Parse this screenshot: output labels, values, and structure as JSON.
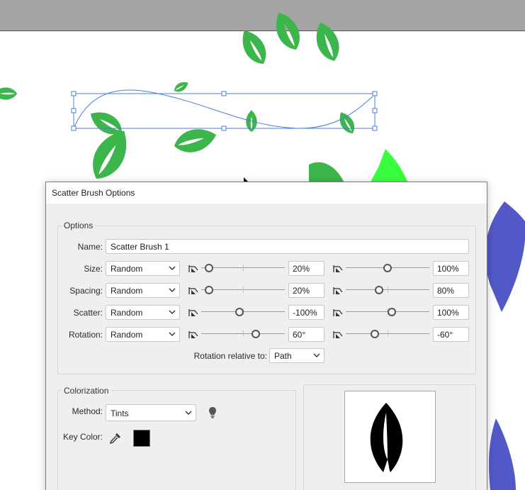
{
  "colors": {
    "leaf_green": "#3cb54a",
    "leaf_bright": "#39ff3f",
    "blue_shape": "#5259c6",
    "path_blue": "#4a7ddb",
    "dialog_bg": "#efefef"
  },
  "dialog": {
    "title": "Scatter Brush Options",
    "options": {
      "group_label": "Options",
      "name_label": "Name:",
      "name_value": "Scatter Brush 1",
      "rows": [
        {
          "label": "Size:",
          "mode": "Random",
          "min_value": "20%",
          "max_value": "100%",
          "min_level": 0.09,
          "max_level": 0.5
        },
        {
          "label": "Spacing:",
          "mode": "Random",
          "min_value": "20%",
          "max_value": "80%",
          "min_level": 0.09,
          "max_level": 0.4
        },
        {
          "label": "Scatter:",
          "mode": "Random",
          "min_value": "-100%",
          "max_value": "100%",
          "min_level": 0.46,
          "max_level": 0.55
        },
        {
          "label": "Rotation:",
          "mode": "Random",
          "min_value": "60°",
          "max_value": "-60°",
          "min_level": 0.65,
          "max_level": 0.35
        }
      ],
      "rotation_relative_label": "Rotation relative to:",
      "rotation_relative_value": "Path"
    },
    "colorization": {
      "group_label": "Colorization",
      "method_label": "Method:",
      "method_value": "Tints",
      "tip_icon": "lightbulb-icon",
      "key_color_label": "Key Color:",
      "eyedropper_icon": "eyedropper-icon",
      "key_color": "#000000"
    },
    "preview_icon": "leaf-preview"
  }
}
